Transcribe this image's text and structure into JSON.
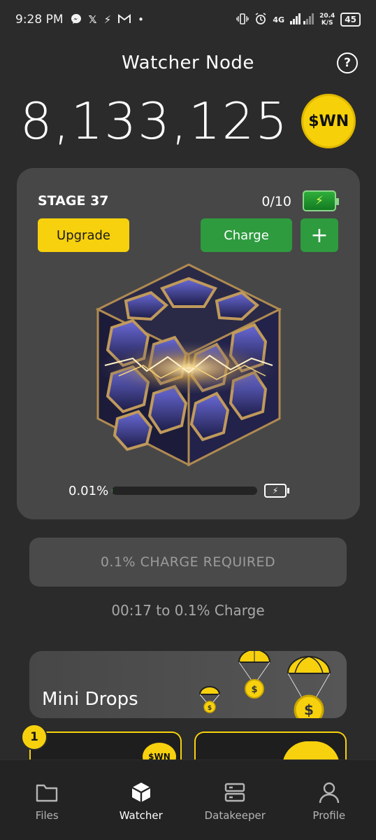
{
  "status_bar": {
    "time": "9:28 PM",
    "network": "4G",
    "speed_value": "20.4",
    "speed_unit": "K/S",
    "battery": "45"
  },
  "header": {
    "title": "Watcher Node"
  },
  "balance": {
    "amount": "8,133,125",
    "token_label": "$WN"
  },
  "stage_card": {
    "stage_label": "STAGE 37",
    "charges": "0/10",
    "upgrade_label": "Upgrade",
    "charge_label": "Charge",
    "plus_label": "+",
    "progress_text": "0.01%",
    "progress_fraction": 0.0001
  },
  "charge_required": {
    "label": "0.1% CHARGE REQUIRED"
  },
  "countdown": {
    "text": "00:17 to 0.1% Charge"
  },
  "mini_drops": {
    "label": "Mini Drops"
  },
  "tiles": {
    "badge": "1",
    "token_label": "$WN"
  },
  "nav": {
    "items": [
      {
        "label": "Files",
        "icon": "folder-icon",
        "active": false
      },
      {
        "label": "Watcher",
        "icon": "cube-icon",
        "active": true
      },
      {
        "label": "Datakeeper",
        "icon": "server-icon",
        "active": false
      },
      {
        "label": "Profile",
        "icon": "user-icon",
        "active": false
      }
    ]
  },
  "colors": {
    "background": "#2b2b2b",
    "card": "#474747",
    "accent_yellow": "#f7d10d",
    "accent_green": "#2e9b3f"
  }
}
